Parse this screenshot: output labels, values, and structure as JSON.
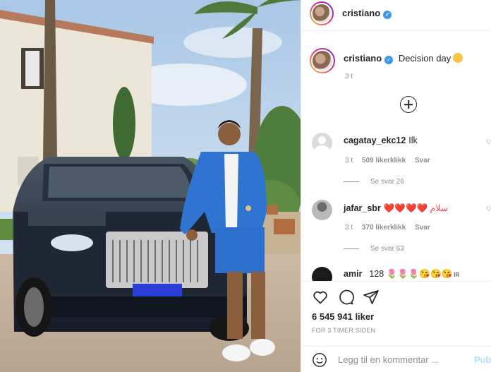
{
  "post": {
    "username": "cristiano",
    "verified_icon": "verified-badge-icon",
    "caption": "Decision day",
    "caption_emoji": "thinking-face-icon",
    "time": "3 t"
  },
  "comments": [
    {
      "username": "cagatay_ekc12",
      "text": "Ilk",
      "time": "3 t",
      "likes": "509 likerklikk",
      "reply": "Svar",
      "view_replies": "Se svar 26"
    },
    {
      "username": "jafar_sbr",
      "text": "❤️❤️❤️❤️ سلام",
      "time": "3 t",
      "likes": "370 likerklikk",
      "reply": "Svar",
      "view_replies": "Se svar 63"
    },
    {
      "username": "amir",
      "text": "128 🌷🌷🌷😘😘😘",
      "suffix": "IR"
    }
  ],
  "actions": {
    "likes": "6 545 941 liker",
    "ago": "FOR 3 TIMER SIDEN"
  },
  "composer": {
    "placeholder": "Legg til en kommentar ...",
    "post_label": "Publiser"
  },
  "colors": {
    "verified": "#3897f0",
    "heart": "#ed4956",
    "muted": "#8e8e8e",
    "post_disabled": "#b2dffc"
  }
}
